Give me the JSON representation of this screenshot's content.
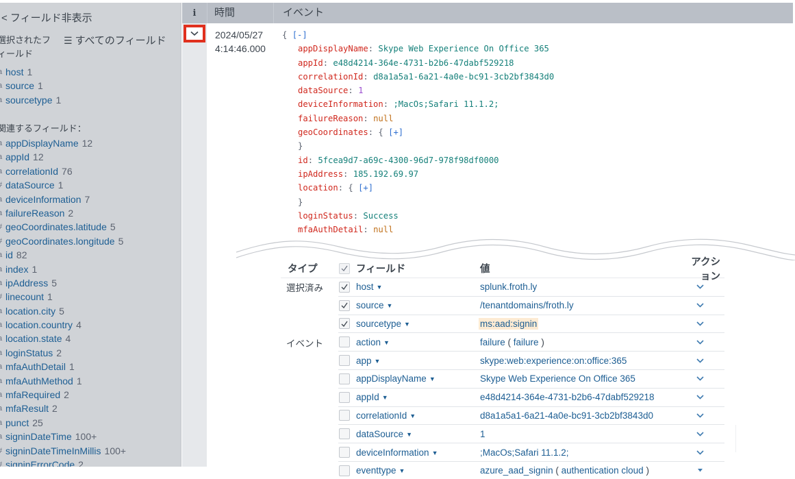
{
  "sidebar": {
    "hide_fields_label": "< フィールド非表示",
    "selected_fields_title": "選択されたフィールド",
    "all_fields_label": "すべてのフィールド",
    "all_fields_icon": "list-icon",
    "related_fields_title": "関連するフィールド：",
    "selected_fields": [
      {
        "type": "a",
        "name": "host",
        "count": "1"
      },
      {
        "type": "a",
        "name": "source",
        "count": "1"
      },
      {
        "type": "a",
        "name": "sourcetype",
        "count": "1"
      }
    ],
    "related_fields": [
      {
        "type": "a",
        "name": "appDisplayName",
        "count": "12"
      },
      {
        "type": "a",
        "name": "appId",
        "count": "12"
      },
      {
        "type": "a",
        "name": "correlationId",
        "count": "76"
      },
      {
        "type": "#",
        "name": "dataSource",
        "count": "1"
      },
      {
        "type": "a",
        "name": "deviceInformation",
        "count": "7"
      },
      {
        "type": "a",
        "name": "failureReason",
        "count": "2"
      },
      {
        "type": "#",
        "name": "geoCoordinates.latitude",
        "count": "5"
      },
      {
        "type": "#",
        "name": "geoCoordinates.longitude",
        "count": "5"
      },
      {
        "type": "a",
        "name": "id",
        "count": "82"
      },
      {
        "type": "a",
        "name": "index",
        "count": "1"
      },
      {
        "type": "a",
        "name": "ipAddress",
        "count": "5"
      },
      {
        "type": "#",
        "name": "linecount",
        "count": "1"
      },
      {
        "type": "a",
        "name": "location.city",
        "count": "5"
      },
      {
        "type": "a",
        "name": "location.country",
        "count": "4"
      },
      {
        "type": "a",
        "name": "location.state",
        "count": "4"
      },
      {
        "type": "a",
        "name": "loginStatus",
        "count": "2"
      },
      {
        "type": "a",
        "name": "mfaAuthDetail",
        "count": "1"
      },
      {
        "type": "a",
        "name": "mfaAuthMethod",
        "count": "1"
      },
      {
        "type": "a",
        "name": "mfaRequired",
        "count": "2"
      },
      {
        "type": "a",
        "name": "mfaResult",
        "count": "2"
      },
      {
        "type": "a",
        "name": "punct",
        "count": "25"
      },
      {
        "type": "a",
        "name": "signinDateTime",
        "count": "100+"
      },
      {
        "type": "#",
        "name": "signinDateTimeInMillis",
        "count": "100+"
      },
      {
        "type": "#",
        "name": "signinErrorCode",
        "count": "2"
      }
    ]
  },
  "events_table": {
    "columns": {
      "info": "i",
      "time": "時間",
      "event": "イベント"
    },
    "expand_icon": "chevron-down-icon",
    "event": {
      "date": "2024/05/27",
      "time": "4:14:46.000",
      "json_open": "{ ",
      "collapse_toggle": "[-]",
      "expand_toggle": "[+]",
      "fields": [
        {
          "key": "appDisplayName",
          "value": "Skype Web Experience On Office 365",
          "kind": "str"
        },
        {
          "key": "appId",
          "value": "e48d4214-364e-4731-b2b6-47dabf529218",
          "kind": "str"
        },
        {
          "key": "correlationId",
          "value": "d8a1a5a1-6a21-4a0e-bc91-3cb2bf3843d0",
          "kind": "str"
        },
        {
          "key": "dataSource",
          "value": "1",
          "kind": "num"
        },
        {
          "key": "deviceInformation",
          "value": ";MacOs;Safari 11.1.2;",
          "kind": "str"
        },
        {
          "key": "failureReason",
          "value": "null",
          "kind": "nul"
        },
        {
          "key": "geoCoordinates",
          "value": "{ ",
          "kind": "obj"
        },
        {
          "key": "id",
          "value": "5fcea9d7-a69c-4300-96d7-978f98df0000",
          "kind": "str"
        },
        {
          "key": "ipAddress",
          "value": "185.192.69.97",
          "kind": "str"
        },
        {
          "key": "location",
          "value": "{ ",
          "kind": "obj"
        },
        {
          "key": "loginStatus",
          "value": "Success",
          "kind": "str"
        },
        {
          "key": "mfaAuthDetail",
          "value": "null",
          "kind": "nul"
        }
      ]
    }
  },
  "field_table": {
    "headers": {
      "type": "タイプ",
      "field": "フィールド",
      "value": "値",
      "action": "アクション"
    },
    "groups": {
      "selected": "選択済み",
      "event": "イベント"
    },
    "rows": [
      {
        "group": "選択済み",
        "checked": true,
        "field": "host",
        "value": "splunk.froth.ly"
      },
      {
        "group": "",
        "checked": true,
        "field": "source",
        "value": "/tenantdomains/froth.ly"
      },
      {
        "group": "",
        "checked": true,
        "field": "sourcetype",
        "value": "ms:aad:signin",
        "highlight": true
      },
      {
        "group": "イベント",
        "checked": false,
        "field": "action",
        "value": "failure",
        "tag": "failure"
      },
      {
        "group": "",
        "checked": false,
        "field": "app",
        "value": "skype:web:experience:on:office:365"
      },
      {
        "group": "",
        "checked": false,
        "field": "appDisplayName",
        "value": "Skype Web Experience On Office 365"
      },
      {
        "group": "",
        "checked": false,
        "field": "appId",
        "value": "e48d4214-364e-4731-b2b6-47dabf529218"
      },
      {
        "group": "",
        "checked": false,
        "field": "correlationId",
        "value": "d8a1a5a1-6a21-4a0e-bc91-3cb2bf3843d0"
      },
      {
        "group": "",
        "checked": false,
        "field": "dataSource",
        "value": "1"
      },
      {
        "group": "",
        "checked": false,
        "field": "deviceInformation",
        "value": ";MacOs;Safari 11.1.2;"
      },
      {
        "group": "",
        "checked": false,
        "field": "eventtype",
        "value": "azure_aad_signin",
        "tag": "authentication  cloud",
        "action_icon": "caret-down-icon"
      }
    ]
  },
  "colors": {
    "accent_highlight": "#e0301e",
    "field_link": "#1d5e93",
    "json_key": "#d0281e",
    "json_string": "#15807a",
    "json_number": "#9b4fcf",
    "json_null": "#c0701a",
    "json_toggle": "#2f6fd0",
    "sidebar_bg": "#d0d3d7",
    "header_bg": "#babfc7",
    "value_highlight": "#fdebd3"
  }
}
